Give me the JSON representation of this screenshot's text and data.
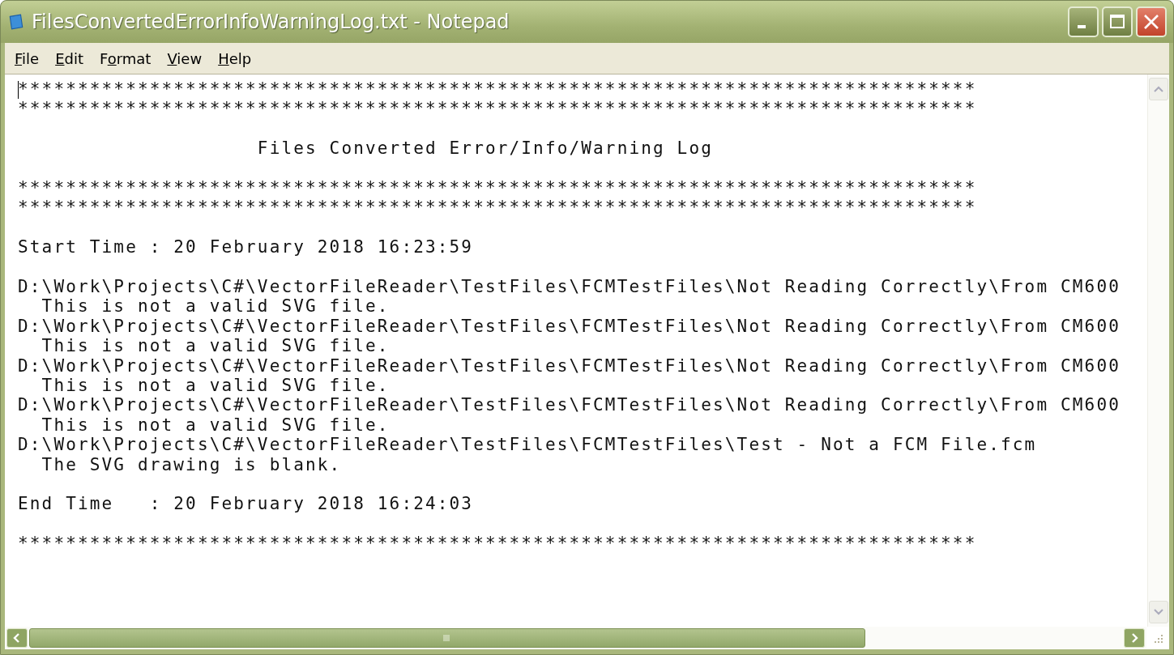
{
  "window": {
    "title": "FilesConvertedErrorInfoWarningLog.txt - Notepad"
  },
  "menu": [
    {
      "access": "F",
      "rest": "ile"
    },
    {
      "access": "E",
      "rest": "dit"
    },
    {
      "lead": "F",
      "access": "o",
      "rest": "rmat"
    },
    {
      "access": "V",
      "rest": "iew"
    },
    {
      "access": "H",
      "rest": "elp"
    }
  ],
  "document": {
    "blocks": [
      {
        "lines": [
          "********************************************************************************",
          "********************************************************************************"
        ]
      },
      {
        "lines": [
          "                    Files Converted Error/Info/Warning Log"
        ]
      },
      {
        "lines": [
          "********************************************************************************",
          "********************************************************************************"
        ]
      },
      {
        "lines": [
          "Start Time : 20 February 2018 16:23:59"
        ]
      },
      {
        "lines": [
          "D:\\Work\\Projects\\C#\\VectorFileReader\\TestFiles\\FCMTestFiles\\Not Reading Correctly\\From CM600",
          "  This is not a valid SVG file.",
          "D:\\Work\\Projects\\C#\\VectorFileReader\\TestFiles\\FCMTestFiles\\Not Reading Correctly\\From CM600",
          "  This is not a valid SVG file.",
          "D:\\Work\\Projects\\C#\\VectorFileReader\\TestFiles\\FCMTestFiles\\Not Reading Correctly\\From CM600",
          "  This is not a valid SVG file.",
          "D:\\Work\\Projects\\C#\\VectorFileReader\\TestFiles\\FCMTestFiles\\Not Reading Correctly\\From CM600",
          "  This is not a valid SVG file.",
          "D:\\Work\\Projects\\C#\\VectorFileReader\\TestFiles\\FCMTestFiles\\Test - Not a FCM File.fcm",
          "  The SVG drawing is blank."
        ]
      },
      {
        "lines": [
          "End Time   : 20 February 2018 16:24:03"
        ]
      },
      {
        "lines": [
          "********************************************************************************"
        ]
      }
    ]
  }
}
